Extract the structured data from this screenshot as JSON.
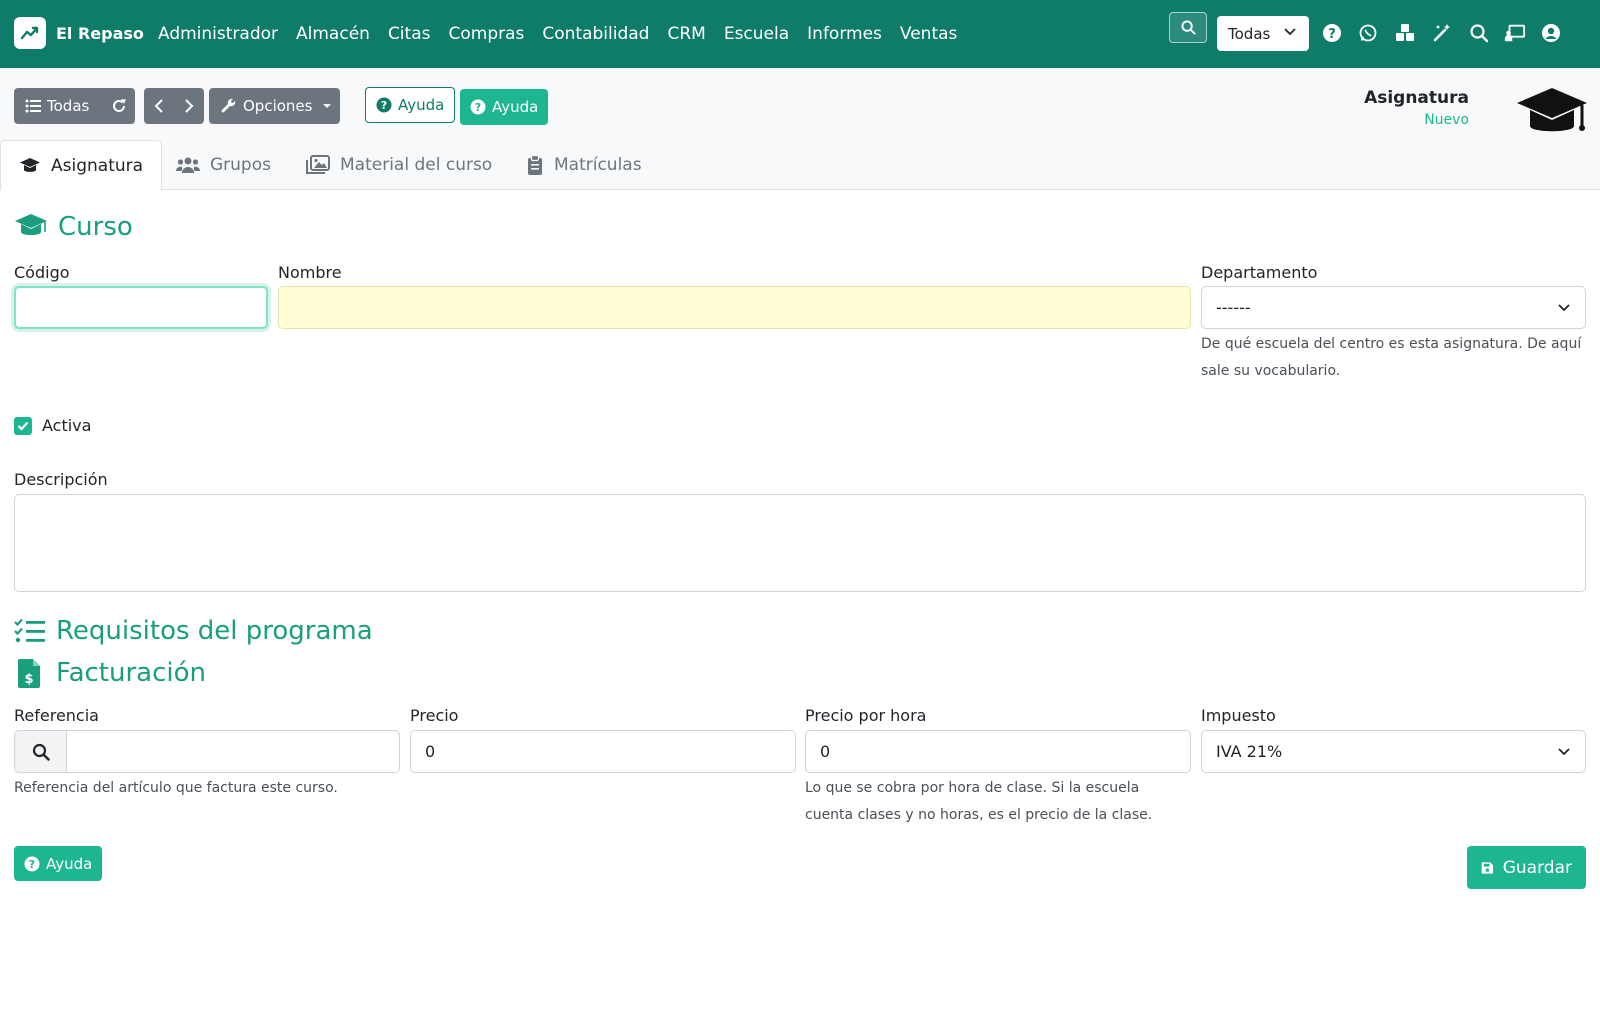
{
  "app": {
    "brand": "El Repaso"
  },
  "nav": {
    "menu": [
      "Administrador",
      "Almacén",
      "Citas",
      "Compras",
      "Contabilidad",
      "CRM",
      "Escuela",
      "Informes",
      "Ventas"
    ],
    "filter_value": "Todas",
    "icons": [
      "help-icon",
      "whatsapp-icon",
      "cubes-icon",
      "magic-wand-icon",
      "search-icon",
      "presentation-icon",
      "user-circle-icon"
    ]
  },
  "toolbar": {
    "list_label": "Todas",
    "options_label": "Opciones",
    "help_outline_label": "Ayuda",
    "help_solid_label": "Ayuda"
  },
  "header": {
    "title": "Asignatura",
    "subtitle": "Nuevo"
  },
  "tabs": [
    {
      "label": "Asignatura",
      "icon": "graduation-cap-icon"
    },
    {
      "label": "Grupos",
      "icon": "users-icon"
    },
    {
      "label": "Material del curso",
      "icon": "images-icon"
    },
    {
      "label": "Matrículas",
      "icon": "clipboard-icon"
    }
  ],
  "curso": {
    "title": "Curso",
    "codigo_label": "Código",
    "codigo_value": "",
    "nombre_label": "Nombre",
    "nombre_value": "",
    "departamento_label": "Departamento",
    "departamento_value": "------",
    "departamento_help": "De qué escuela del centro es esta asignatura. De aquí sale su vocabulario.",
    "activa_label": "Activa",
    "activa_checked": true,
    "descripcion_label": "Descripción",
    "descripcion_value": ""
  },
  "requisitos": {
    "title": "Requisitos del programa"
  },
  "facturacion": {
    "title": "Facturación",
    "referencia_label": "Referencia",
    "referencia_value": "",
    "referencia_help": "Referencia del artículo que factura este curso.",
    "precio_label": "Precio",
    "precio_value": "0",
    "precio_hora_label": "Precio por hora",
    "precio_hora_value": "0",
    "precio_hora_help": "Lo que se cobra por hora de clase. Si la escuela cuenta clases y no horas, es el precio de la clase.",
    "impuesto_label": "Impuesto",
    "impuesto_value": "IVA 21%"
  },
  "footer": {
    "help_label": "Ayuda",
    "save_label": "Guardar"
  },
  "colors": {
    "navbar": "#0f7c6a",
    "accent": "#1eb691",
    "section": "#1a9e7e"
  }
}
